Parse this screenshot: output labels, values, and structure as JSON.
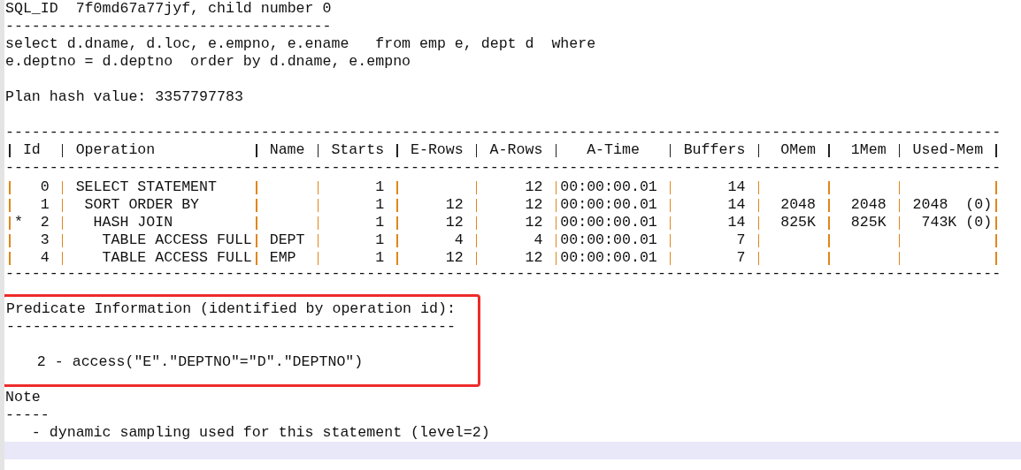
{
  "sql_header": {
    "text": "SQL_ID  7f0md67a77jyf, child number 0",
    "rule": "-------------------------------------"
  },
  "statement": [
    "select d.dname, d.loc, e.empno, e.ename   from emp e, dept d  where",
    "e.deptno = d.deptno  order by d.dname, e.empno"
  ],
  "plan_hash": "Plan hash value: 3357797783",
  "plan_table": {
    "top_rule": "-----------------------------------------------------------------------------------------------------------------",
    "columns": [
      "Id",
      "Operation",
      "Name",
      "Starts",
      "E-Rows",
      "A-Rows",
      "A-Time",
      "Buffers",
      "OMem",
      "1Mem",
      "Used-Mem"
    ],
    "header_rule": "-----------------------------------------------------------------------------------------------------------------",
    "rows": [
      {
        "id": "0",
        "operation": "SELECT STATEMENT",
        "starts": "1",
        "a_rows": "12",
        "a_time": "00:00:00.01",
        "buffers": "14",
        "children": [
          {
            "id": "1",
            "operation": "SORT ORDER BY",
            "starts": "1",
            "e_rows": "12",
            "a_rows": "12",
            "a_time": "00:00:00.01",
            "buffers": "14",
            "omem": "2048",
            "one_mem": "2048",
            "used_mem": "2048  (0)",
            "children": [
              {
                "marker": "*",
                "id": "2",
                "operation": "HASH JOIN",
                "starts": "1",
                "e_rows": "12",
                "a_rows": "12",
                "a_time": "00:00:00.01",
                "buffers": "14",
                "omem": "825K",
                "one_mem": "825K",
                "used_mem": "743K (0)",
                "children": [
                  {
                    "id": "3",
                    "operation": "TABLE ACCESS FULL",
                    "name": "DEPT",
                    "starts": "1",
                    "e_rows": "4",
                    "a_rows": "4",
                    "a_time": "00:00:00.01",
                    "buffers": "7"
                  },
                  {
                    "id": "4",
                    "operation": "TABLE ACCESS FULL",
                    "name": "EMP",
                    "starts": "1",
                    "e_rows": "12",
                    "a_rows": "12",
                    "a_time": "00:00:00.01",
                    "buffers": "7"
                  }
                ]
              }
            ]
          }
        ]
      }
    ],
    "bottom_rule": "-----------------------------------------------------------------------------------------------------------------"
  },
  "predicate_section": {
    "title": "Predicate Information (identified by operation id):",
    "rule": "---------------------------------------------------",
    "items": [
      "2 - access(\"E\".\"DEPTNO\"=\"D\".\"DEPTNO\")"
    ]
  },
  "note_section": {
    "title": "Note",
    "rule": "-----",
    "items": [
      "- dynamic sampling used for this statement (level=2)"
    ]
  }
}
